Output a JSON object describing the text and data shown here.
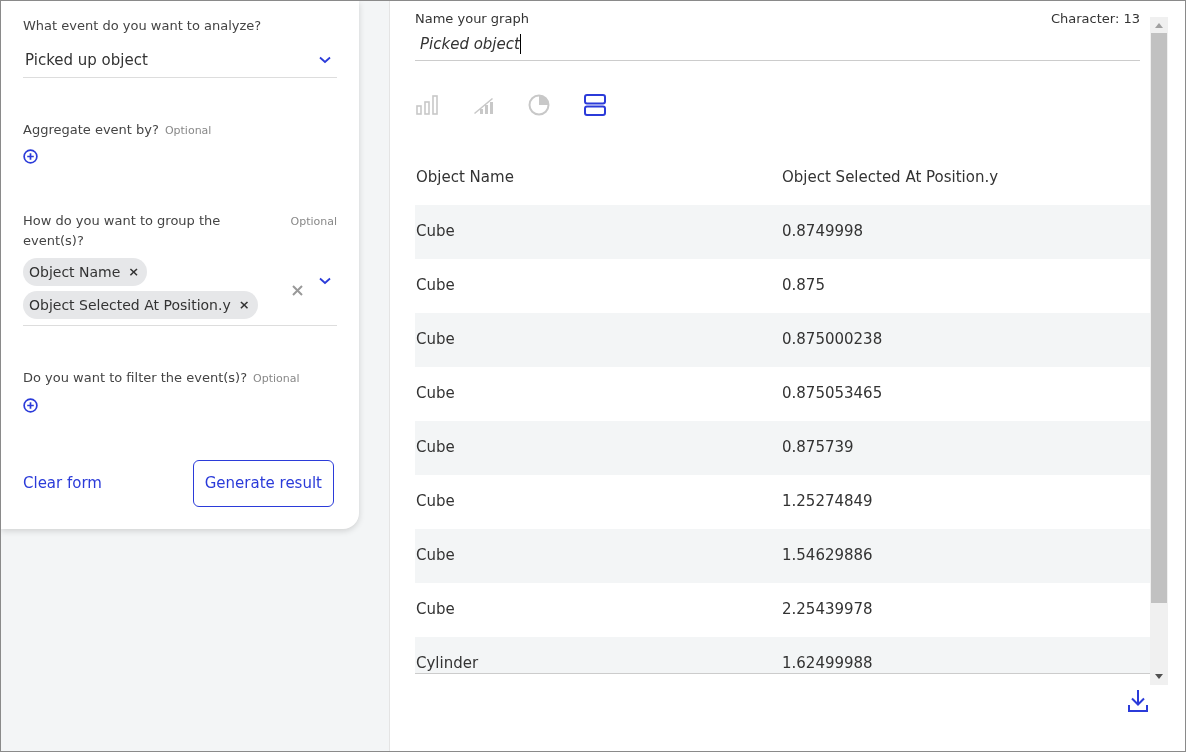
{
  "form": {
    "event_question": {
      "label": "What event do you want to analyze?",
      "value": "Picked up object"
    },
    "aggregate": {
      "label": "Aggregate event by?",
      "optional": "Optional"
    },
    "group": {
      "label": "How do you want to group the event(s)?",
      "optional": "Optional",
      "chips": [
        {
          "label": "Object Name",
          "remove": "×"
        },
        {
          "label": "Object Selected At Position.y",
          "remove": "×"
        }
      ]
    },
    "filter": {
      "label": "Do you want to filter the event(s)?",
      "optional": "Optional"
    },
    "clear_button": "Clear form",
    "generate_button": "Generate result"
  },
  "graph": {
    "name_label": "Name your graph",
    "character_count": "Character: 13",
    "name_value": "Picked object",
    "chart_types": [
      {
        "kind": "bar",
        "selected": false
      },
      {
        "kind": "line",
        "selected": false
      },
      {
        "kind": "pie",
        "selected": false
      },
      {
        "kind": "table",
        "selected": true
      }
    ]
  },
  "table": {
    "columns": [
      "Object Name",
      "Object Selected At Position.y"
    ],
    "rows": [
      [
        "Cube",
        "0.8749998"
      ],
      [
        "Cube",
        "0.875"
      ],
      [
        "Cube",
        "0.875000238"
      ],
      [
        "Cube",
        "0.875053465"
      ],
      [
        "Cube",
        "0.875739"
      ],
      [
        "Cube",
        "1.25274849"
      ],
      [
        "Cube",
        "1.54629886"
      ],
      [
        "Cube",
        "2.25439978"
      ],
      [
        "Cylinder",
        "1.62499988"
      ]
    ]
  }
}
